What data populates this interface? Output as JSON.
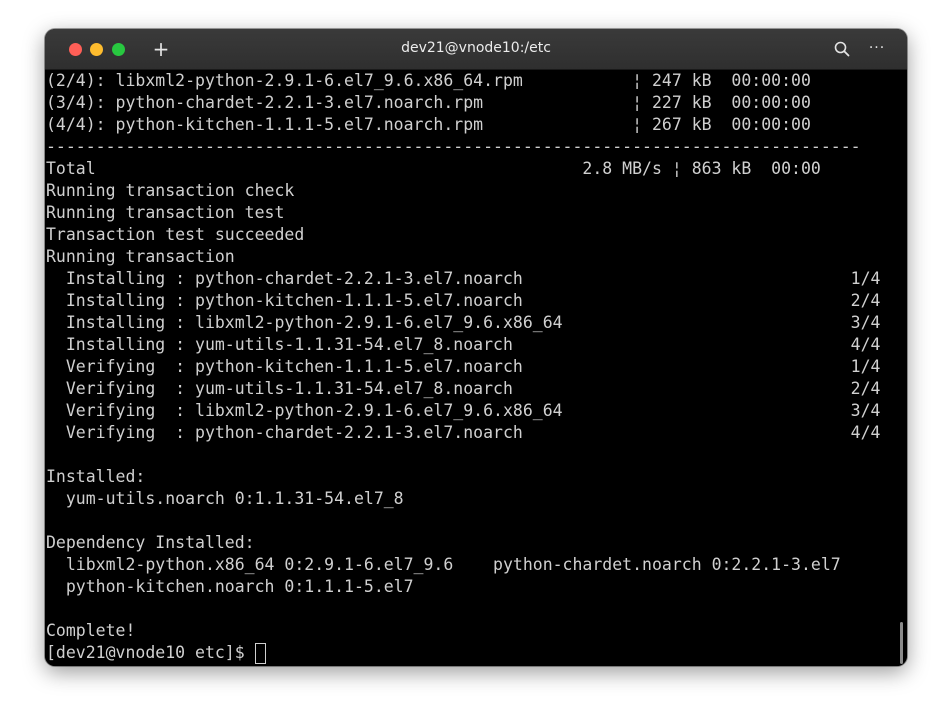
{
  "window": {
    "title": "dev21@vnode10:/etc",
    "new_tab_glyph": "+",
    "more_glyph": "···",
    "icons": [
      "close-dot",
      "minimize-dot",
      "zoom-dot",
      "plus-icon",
      "search-icon",
      "more-icon"
    ]
  },
  "terminal": {
    "lines": [
      "(2/4): libxml2-python-2.9.1-6.el7_9.6.x86_64.rpm           ¦ 247 kB  00:00:00",
      "(3/4): python-chardet-2.2.1-3.el7.noarch.rpm               ¦ 227 kB  00:00:00",
      "(4/4): python-kitchen-1.1.1-5.el7.noarch.rpm               ¦ 267 kB  00:00:00",
      "----------------------------------------------------------------------------------",
      "Total                                                 2.8 MB/s ¦ 863 kB  00:00",
      "Running transaction check",
      "Running transaction test",
      "Transaction test succeeded",
      "Running transaction",
      "  Installing : python-chardet-2.2.1-3.el7.noarch                                 1/4",
      "  Installing : python-kitchen-1.1.1-5.el7.noarch                                 2/4",
      "  Installing : libxml2-python-2.9.1-6.el7_9.6.x86_64                             3/4",
      "  Installing : yum-utils-1.1.31-54.el7_8.noarch                                  4/4",
      "  Verifying  : python-kitchen-1.1.1-5.el7.noarch                                 1/4",
      "  Verifying  : yum-utils-1.1.31-54.el7_8.noarch                                  2/4",
      "  Verifying  : libxml2-python-2.9.1-6.el7_9.6.x86_64                             3/4",
      "  Verifying  : python-chardet-2.2.1-3.el7.noarch                                 4/4",
      "",
      "Installed:",
      "  yum-utils.noarch 0:1.1.31-54.el7_8",
      "",
      "Dependency Installed:",
      "  libxml2-python.x86_64 0:2.9.1-6.el7_9.6    python-chardet.noarch 0:2.2.1-3.el7",
      "  python-kitchen.noarch 0:1.1.1-5.el7",
      "",
      "Complete!",
      "[dev21@vnode10 etc]$ "
    ]
  }
}
